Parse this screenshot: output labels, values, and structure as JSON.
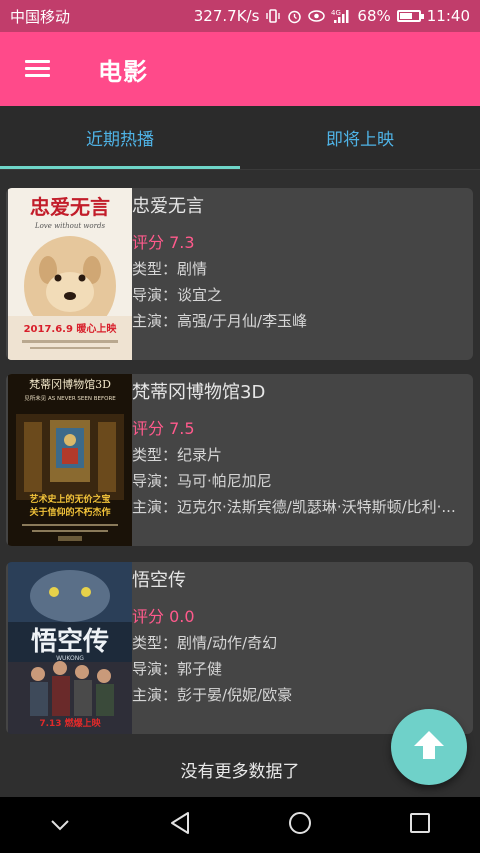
{
  "status_bar": {
    "carrier": "中国移动",
    "speed": "327.7K/s",
    "vibrate_icon": "vibrate-icon",
    "alarm_icon": "alarm-icon",
    "eye_icon": "eye-comfort-icon",
    "network_label": "4G",
    "battery_text": "68%",
    "battery_level": 0.68,
    "time": "11:40"
  },
  "app_bar": {
    "title": "电影",
    "menu_icon": "menu-icon"
  },
  "tabs": [
    {
      "label": "近期热播",
      "active": true
    },
    {
      "label": "即将上映",
      "active": false
    }
  ],
  "movies": [
    {
      "title": "忠爱无言",
      "score": "评分 7.3",
      "genre": "类型：剧情",
      "director": "导演：谈宜之",
      "cast": "主演：高强/于月仙/李玉峰",
      "poster": {
        "title": "忠爱无言",
        "subtitle": "Love without words",
        "date_text": "2017.6.9 暖心上映"
      }
    },
    {
      "title": "梵蒂冈博物馆3D",
      "score": "评分 7.5",
      "genre": "类型：纪录片",
      "director": "导演：马可·帕尼加尼",
      "cast": "主演：迈克尔·法斯宾德/凯瑟琳·沃特斯顿/比利·...",
      "poster": {
        "title": "梵蒂冈博物馆3D",
        "tagline_top": "见所未见 AS NEVER SEEN BEFORE",
        "tagline_mid": "艺术史上的无价之宝",
        "tagline_bottom": "关于信仰的不朽杰作"
      }
    },
    {
      "title": "悟空传",
      "score": "评分 0.0",
      "genre": "类型：剧情/动作/奇幻",
      "director": "导演：郭子健",
      "cast": "主演：彭于晏/倪妮/欧豪",
      "poster": {
        "title": "悟空传",
        "subtitle": "WUKONG",
        "date_text": "7.13 燃爆上映"
      }
    }
  ],
  "footer": {
    "load_more_text": "没有更多数据了"
  },
  "fab": {
    "icon": "arrow-up-icon"
  },
  "nav_bar": {
    "back_icon": "back-triangle-icon",
    "home_icon": "home-circle-icon",
    "recents_icon": "recents-square-icon",
    "hide_icon": "chevron-down-icon"
  },
  "colors": {
    "status_bar": "#c13d6b",
    "app_bar": "#ff4a8a",
    "tab_text": "#4fb3e6",
    "tab_indicator": "#6fd6c9",
    "score": "#ff5a8c",
    "card_bg": "#454545",
    "fab": "#6fd1c9"
  }
}
